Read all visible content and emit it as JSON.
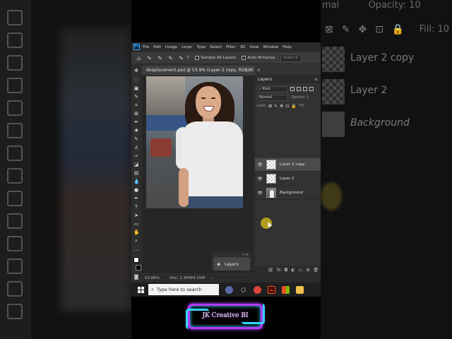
{
  "menubar": {
    "logo": "Ps",
    "items": [
      "File",
      "Edit",
      "Image",
      "Layer",
      "Type",
      "Select",
      "Filter",
      "3D",
      "View",
      "Window",
      "Help"
    ]
  },
  "options_bar": {
    "brush_size": "7",
    "sample_all_layers": "Sample All Layers",
    "auto_enhance": "Auto-Enhance",
    "select_subject": "Select S"
  },
  "document": {
    "tab_title": "desplacement.psd @ 53.9% (Layer 2 copy, RGB/8)",
    "tab_close": "×"
  },
  "status_bar": {
    "zoom": "53.86%",
    "doc_info": "Doc: 1.35M/4.15M",
    "arrow": "›"
  },
  "mini_layers_panel": {
    "label": "Layers",
    "controls": "» ×"
  },
  "layers_panel": {
    "title": "Layers",
    "filter_kind": "Kind",
    "blend_mode": "Normal",
    "opacity_label": "Opacity: 1",
    "lock_label": "Lock:",
    "fill_label": "Fill:",
    "layers": [
      {
        "name": "Layer 2 copy",
        "visible": true,
        "selected": true,
        "italic": false
      },
      {
        "name": "Layer 2",
        "visible": true,
        "selected": false,
        "italic": false
      },
      {
        "name": "Background",
        "visible": true,
        "selected": false,
        "italic": true
      }
    ],
    "footer_icons": [
      "link-icon",
      "fx-icon",
      "mask-icon",
      "adjustment-icon",
      "group-icon",
      "new-layer-icon",
      "trash-icon"
    ]
  },
  "taskbar": {
    "search_placeholder": "Type here to search"
  },
  "background_ghost": {
    "top_text": "mal",
    "opacity_text": "Opacity: 10",
    "fill_text": "Fill: 10",
    "layers": [
      "Layer 2 copy",
      "Layer 2",
      "Background"
    ]
  },
  "watermark": {
    "text": "JK Creative BI"
  },
  "colors": {
    "ps_accent": "#31a8ff",
    "selection_bg": "#4b4b4b",
    "cursor_highlight": "#c8b21c",
    "watermark_purple": "#b43cff",
    "watermark_cyan": "#2fd8ff"
  }
}
